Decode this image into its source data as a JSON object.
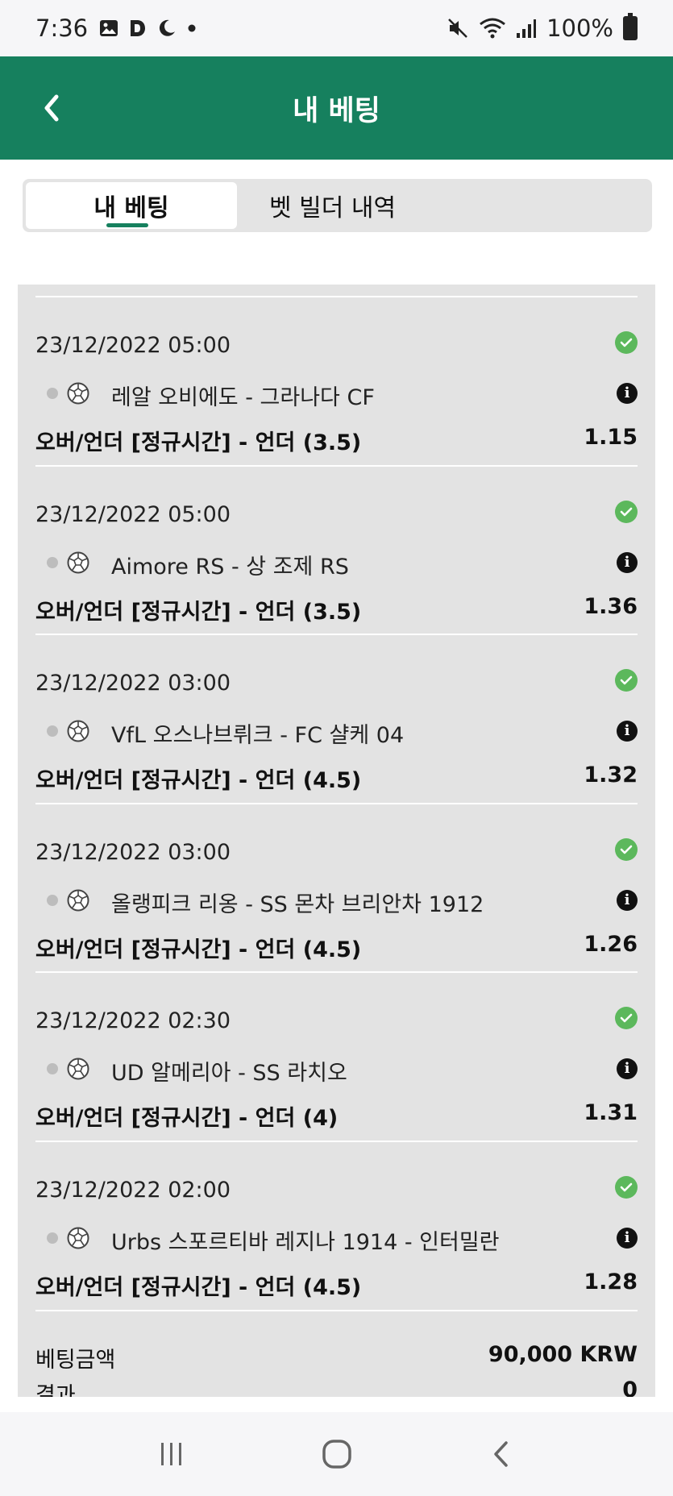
{
  "status": {
    "time": "7:36",
    "battery": "100%"
  },
  "header": {
    "title": "내 베팅"
  },
  "tabs": [
    {
      "label": "내 베팅",
      "active": true
    },
    {
      "label": "벳 빌더 내역",
      "active": false
    }
  ],
  "bets": [
    {
      "date": "23/12/2022 05:00",
      "match": "레알 오비에도 - 그라나다 CF",
      "market": "오버/언더 [정규시간] - 언더 (3.5)",
      "odds": "1.15"
    },
    {
      "date": "23/12/2022 05:00",
      "match": "Aimore RS - 상 조제 RS",
      "market": "오버/언더 [정규시간] - 언더 (3.5)",
      "odds": "1.36"
    },
    {
      "date": "23/12/2022 03:00",
      "match": "VfL 오스나브뤼크 - FC 샬케 04",
      "market": "오버/언더 [정규시간] - 언더 (4.5)",
      "odds": "1.32"
    },
    {
      "date": "23/12/2022 03:00",
      "match": "올랭피크 리옹 - SS 몬차 브리안차 1912",
      "market": "오버/언더 [정규시간] - 언더 (4.5)",
      "odds": "1.26"
    },
    {
      "date": "23/12/2022 02:30",
      "match": "UD 알메리아 - SS 라치오",
      "market": "오버/언더 [정규시간] - 언더 (4)",
      "odds": "1.31"
    },
    {
      "date": "23/12/2022 02:00",
      "match": "Urbs 스포르티바 레지나 1914 - 인터밀란",
      "market": "오버/언더 [정규시간] - 언더 (4.5)",
      "odds": "1.28"
    }
  ],
  "summary": {
    "stake_label": "베팅금액",
    "stake_value": "90,000 KRW",
    "result_label": "결과",
    "result_value": "0"
  },
  "colors": {
    "brand": "#16805e",
    "win": "#5cb85c"
  }
}
